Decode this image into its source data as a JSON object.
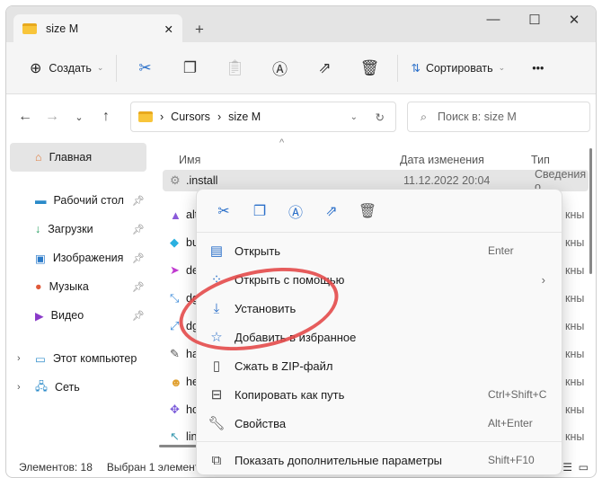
{
  "window": {
    "tab_title": "size M",
    "new_tab": "+",
    "minimize": "—",
    "maximize": "☐",
    "close": "✕",
    "tab_close": "✕"
  },
  "toolbar": {
    "create": "Создать",
    "sort": "Сортировать",
    "more": "•••"
  },
  "address": {
    "crumbs": [
      "Cursors",
      "size M"
    ],
    "search_placeholder": "Поиск в: size M"
  },
  "sidebar": {
    "items": [
      {
        "label": "Главная"
      },
      {
        "label": "Рабочий стол"
      },
      {
        "label": "Загрузки"
      },
      {
        "label": "Изображения"
      },
      {
        "label": "Музыка"
      },
      {
        "label": "Видео"
      },
      {
        "label": "Этот компьютер"
      },
      {
        "label": "Сеть"
      }
    ]
  },
  "list": {
    "headers": {
      "name": "Имя",
      "date": "Дата изменения",
      "type": "Тип"
    },
    "rows": [
      {
        "name": ".install",
        "date": "11.12.2022 20:04",
        "type": "Сведения о"
      },
      {
        "name": "alt",
        "type": "кны"
      },
      {
        "name": "bu",
        "type": "кны"
      },
      {
        "name": "de",
        "type": "кны"
      },
      {
        "name": "dg",
        "type": "кны"
      },
      {
        "name": "dg",
        "type": "кны"
      },
      {
        "name": "ha",
        "type": "кны"
      },
      {
        "name": "he",
        "type": "кны"
      },
      {
        "name": "ho",
        "type": "кны"
      },
      {
        "name": "lin",
        "type": "кны"
      }
    ]
  },
  "status": {
    "count": "Элементов: 18",
    "selected": "Выбран 1 элемент"
  },
  "menu": {
    "items": [
      {
        "label": "Открыть",
        "shortcut": "Enter"
      },
      {
        "label": "Открыть с помощью"
      },
      {
        "label": "Установить"
      },
      {
        "label": "Добавить в избранное"
      },
      {
        "label": "Сжать в ZIP-файл"
      },
      {
        "label": "Копировать как путь",
        "shortcut": "Ctrl+Shift+C"
      },
      {
        "label": "Свойства",
        "shortcut": "Alt+Enter"
      },
      {
        "label": "Показать дополнительные параметры",
        "shortcut": "Shift+F10"
      }
    ]
  },
  "colors": {
    "accent": "#2a6fc9",
    "highlight_ring": "#e34a4a"
  }
}
